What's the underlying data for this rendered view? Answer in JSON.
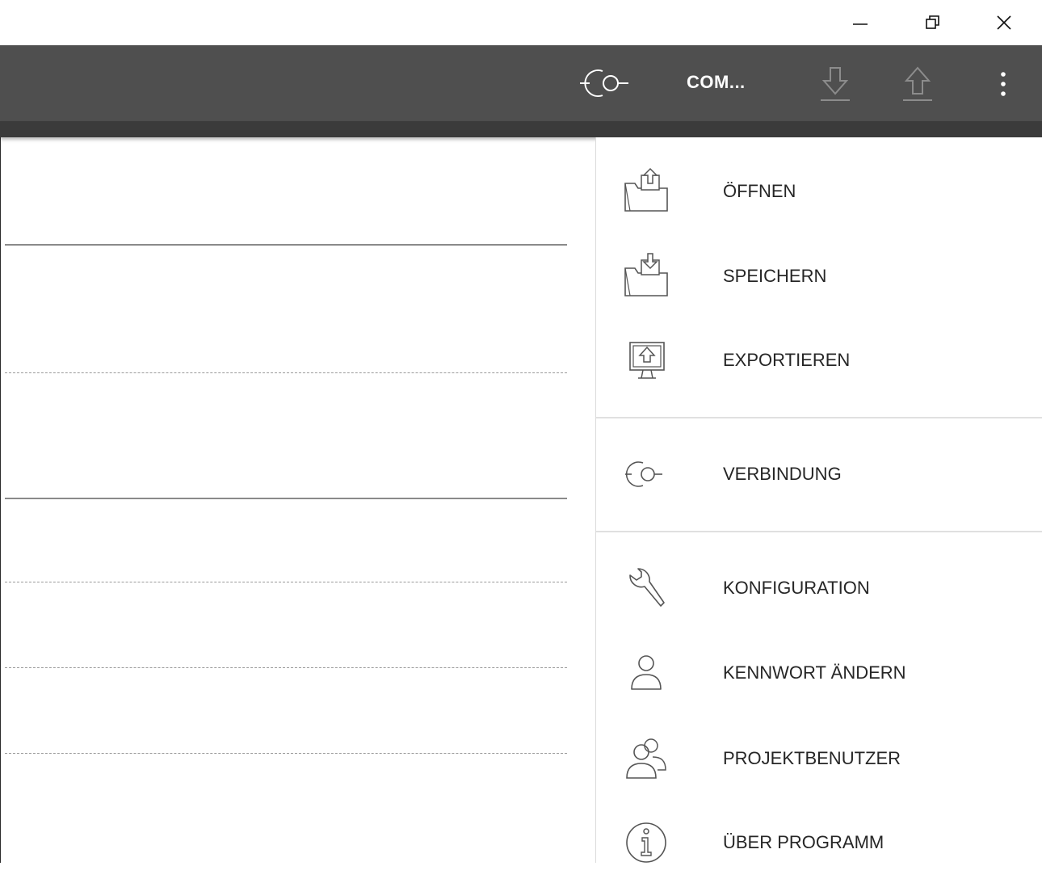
{
  "window": {
    "minimize_glyph": "—",
    "restore_glyph": "❐",
    "close_glyph": "✕"
  },
  "appbar": {
    "connection_label": "COM...",
    "icons": [
      "connection-icon",
      "download-icon",
      "upload-icon",
      "more-vert-icon"
    ],
    "background": "#4f4f4f"
  },
  "menu": {
    "items": [
      {
        "label": "ÖFFNEN",
        "icon": "folder-open-icon"
      },
      {
        "label": "SPEICHERN",
        "icon": "folder-save-icon"
      },
      {
        "label": "EXPORTIEREN",
        "icon": "export-icon"
      },
      {
        "label": "VERBINDUNG",
        "icon": "connection-icon"
      },
      {
        "label": "KONFIGURATION",
        "icon": "wrench-icon"
      },
      {
        "label": "KENNWORT ÄNDERN",
        "icon": "user-icon"
      },
      {
        "label": "PROJEKTBENUTZER",
        "icon": "users-icon"
      },
      {
        "label": "ÜBER PROGRAMM",
        "icon": "info-icon"
      }
    ]
  }
}
